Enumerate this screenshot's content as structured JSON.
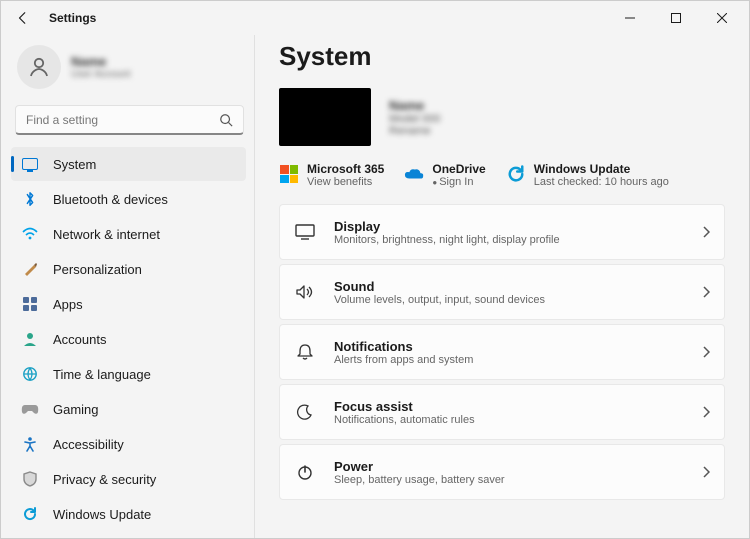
{
  "titlebar": {
    "title": "Settings"
  },
  "account": {
    "name": "Name",
    "sub": "User Account"
  },
  "search": {
    "placeholder": "Find a setting"
  },
  "sidebar": {
    "items": [
      {
        "label": "System"
      },
      {
        "label": "Bluetooth & devices"
      },
      {
        "label": "Network & internet"
      },
      {
        "label": "Personalization"
      },
      {
        "label": "Apps"
      },
      {
        "label": "Accounts"
      },
      {
        "label": "Time & language"
      },
      {
        "label": "Gaming"
      },
      {
        "label": "Accessibility"
      },
      {
        "label": "Privacy & security"
      },
      {
        "label": "Windows Update"
      }
    ]
  },
  "main": {
    "title": "System",
    "device": {
      "name": "Name",
      "model": "Model 000",
      "rename": "Rename"
    },
    "services": {
      "ms365": {
        "title": "Microsoft 365",
        "sub": "View benefits"
      },
      "onedrive": {
        "title": "OneDrive",
        "sub": "Sign In"
      },
      "update": {
        "title": "Windows Update",
        "sub": "Last checked: 10 hours ago"
      }
    },
    "cards": [
      {
        "title": "Display",
        "sub": "Monitors, brightness, night light, display profile"
      },
      {
        "title": "Sound",
        "sub": "Volume levels, output, input, sound devices"
      },
      {
        "title": "Notifications",
        "sub": "Alerts from apps and system"
      },
      {
        "title": "Focus assist",
        "sub": "Notifications, automatic rules"
      },
      {
        "title": "Power",
        "sub": "Sleep, battery usage, battery saver"
      }
    ]
  }
}
